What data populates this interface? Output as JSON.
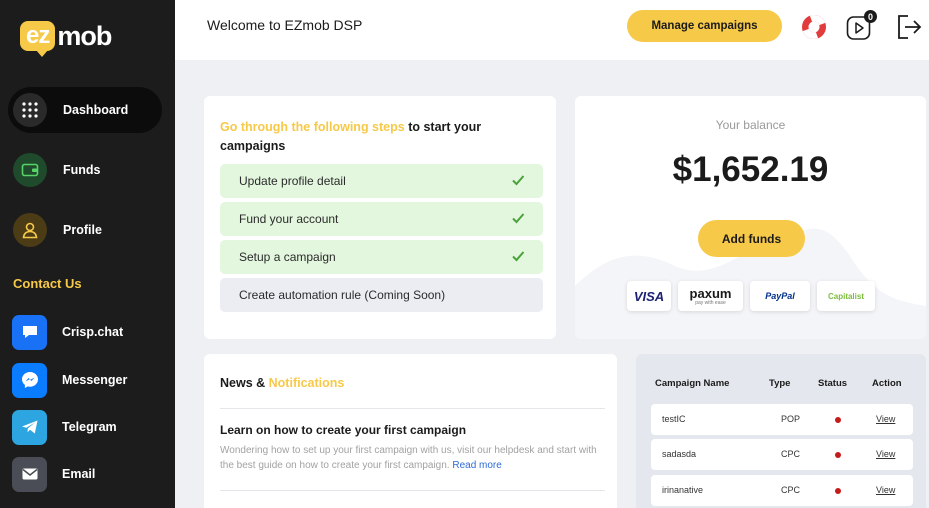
{
  "brand": {
    "logo_left": "ez",
    "logo_right": "mob",
    "accent": "#f7c948"
  },
  "sidebar": {
    "items": [
      {
        "label": "Dashboard",
        "icon": "grid-icon",
        "active": true
      },
      {
        "label": "Funds",
        "icon": "wallet-icon",
        "active": false
      },
      {
        "label": "Profile",
        "icon": "user-icon",
        "active": false
      }
    ],
    "contact_title": "Contact Us",
    "contacts": [
      {
        "label": "Crisp.chat",
        "icon": "chat-icon",
        "color": "#1972f5"
      },
      {
        "label": "Messenger",
        "icon": "messenger-icon",
        "color": "#0a7cff"
      },
      {
        "label": "Telegram",
        "icon": "telegram-icon",
        "color": "#2ca5e0"
      },
      {
        "label": "Email",
        "icon": "email-icon",
        "color": "#4a4d55"
      }
    ]
  },
  "header": {
    "welcome": "Welcome to EZmob DSP",
    "manage_label": "Manage campaigns",
    "notification_count": "0"
  },
  "steps": {
    "title_highlight": "Go through the following steps",
    "title_rest": "to start your campaigns",
    "items": [
      {
        "label": "Update profile detail",
        "done": true
      },
      {
        "label": "Fund your account",
        "done": true
      },
      {
        "label": "Setup a campaign",
        "done": true
      },
      {
        "label": "Create automation rule (Coming Soon)",
        "done": false
      }
    ]
  },
  "balance": {
    "label": "Your balance",
    "amount": "$1,652.19",
    "add_funds_label": "Add funds",
    "payment_methods": [
      "VISA",
      "paxum",
      "PayPal",
      "Capitalist"
    ],
    "paxum_sub": "pay with ease"
  },
  "news": {
    "title_plain": "News &",
    "title_highlight": "Notifications",
    "article_title": "Learn on how to create your first campaign",
    "article_body": "Wondering how to set up your first campaign with us, visit our helpdesk and start with the best guide on how to create your first campaign.",
    "read_more": "Read more"
  },
  "campaigns": {
    "headers": [
      "Campaign Name",
      "Type",
      "Status",
      "Action"
    ],
    "rows": [
      {
        "name": "testIC",
        "type": "POP",
        "action": "View"
      },
      {
        "name": "sadasda",
        "type": "CPC",
        "action": "View"
      },
      {
        "name": "irinanative",
        "type": "CPC",
        "action": "View"
      }
    ],
    "status_color": "#c51b1b"
  }
}
